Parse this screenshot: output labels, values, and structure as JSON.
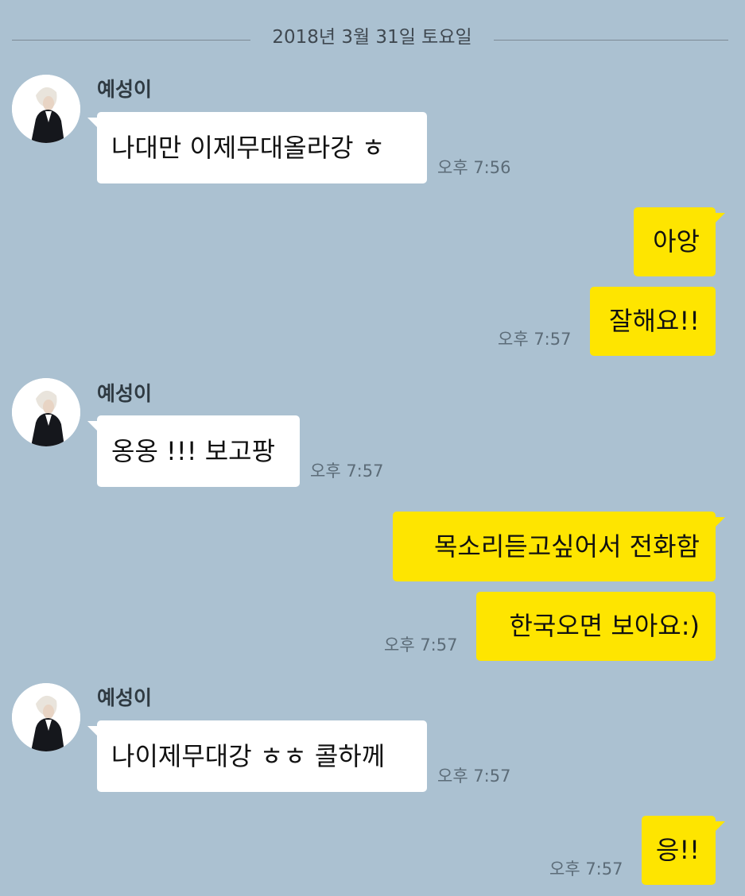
{
  "date_divider": "2018년 3월 31일 토요일",
  "sender_name": "예성이",
  "messages": [
    {
      "text": "나대만 이제무대올라강 ㅎ",
      "time": "오후 7:56"
    },
    {
      "text": "아앙"
    },
    {
      "text": "잘해요!!",
      "time": "오후 7:57"
    },
    {
      "text": "옹옹 !!! 보고팡",
      "time": "오후 7:57"
    },
    {
      "text": "목소리듣고싶어서 전화함"
    },
    {
      "text": "한국오면 보아요:)",
      "time": "오후 7:57"
    },
    {
      "text": "나이제무대강 ㅎㅎ 콜하께",
      "time": "오후 7:57"
    },
    {
      "text": "응!!",
      "time": "오후 7:57"
    }
  ],
  "colors": {
    "background": "#abc1d1",
    "received_bubble": "#ffffff",
    "sent_bubble": "#fee500"
  }
}
